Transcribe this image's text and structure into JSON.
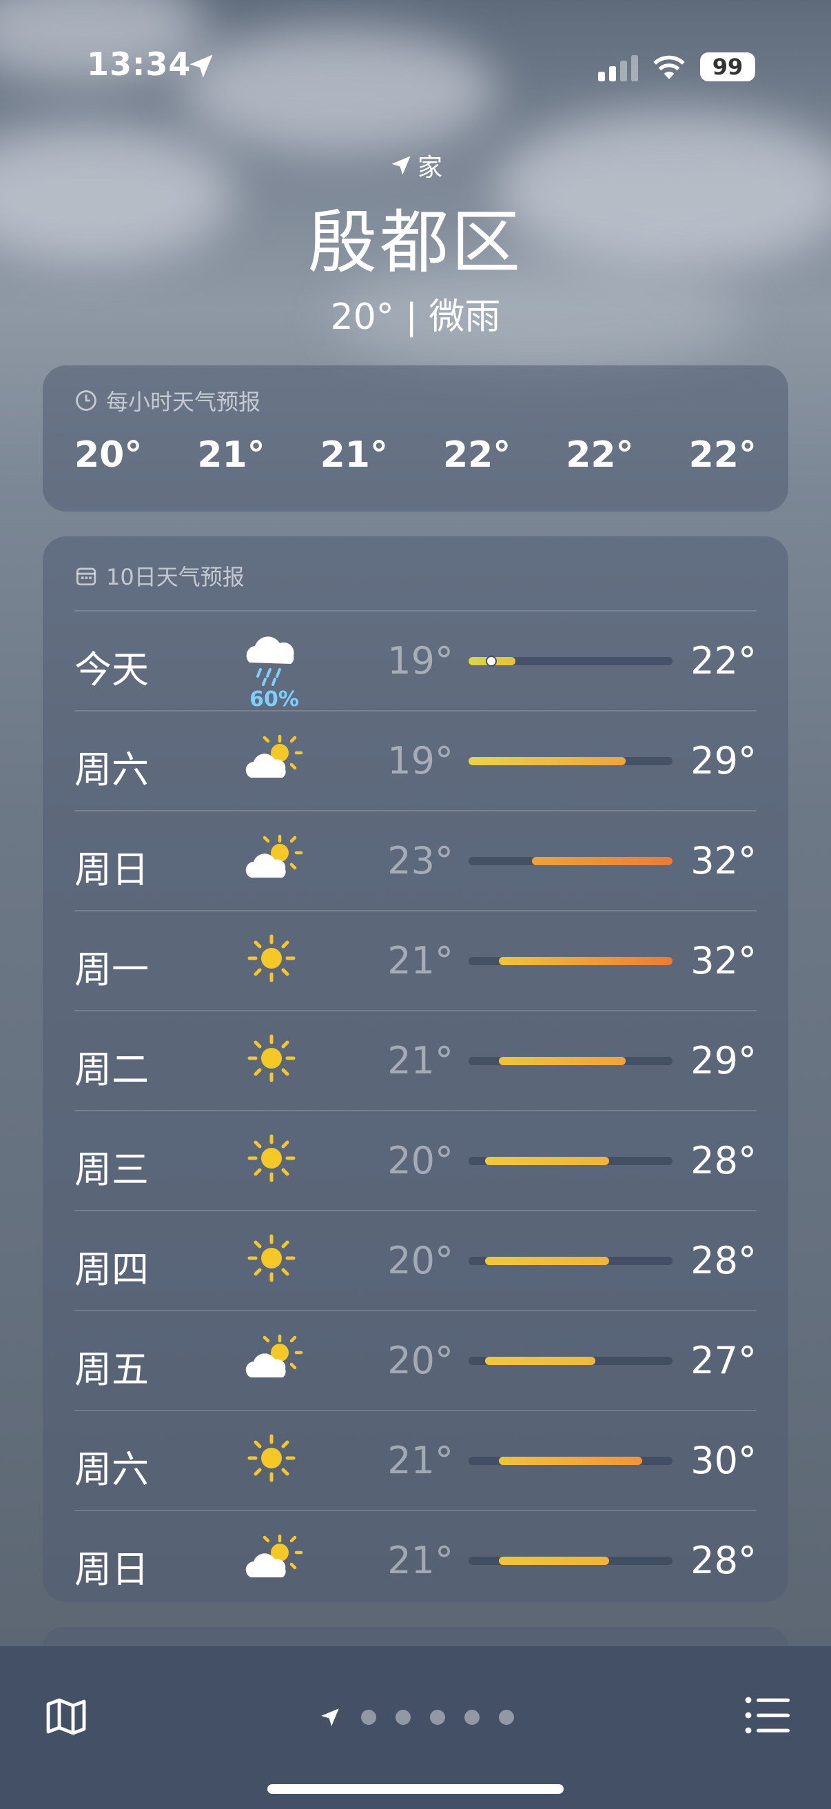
{
  "status": {
    "time": "13:34",
    "battery": "99"
  },
  "location": {
    "home_label": "家",
    "city": "殷都区",
    "current": "20° | 微雨"
  },
  "hourly": {
    "title": "每小时天气预报",
    "temps": [
      "20°",
      "21°",
      "21°",
      "22°",
      "22°",
      "22°"
    ]
  },
  "daily": {
    "title": "10日天气预报",
    "days": [
      {
        "day": "今天",
        "icon": "cloud-rain-icon",
        "precip": "60%",
        "low": "19°",
        "high": "22°",
        "range_start": 0.0,
        "range_end": 0.23,
        "current_marker": 0.11,
        "colors": [
          "#d8d54a",
          "#e8c23a"
        ]
      },
      {
        "day": "周六",
        "icon": "partly-sunny-icon",
        "precip": "",
        "low": "19°",
        "high": "29°",
        "range_start": 0.0,
        "range_end": 0.77,
        "colors": [
          "#ead34a",
          "#efa53c"
        ]
      },
      {
        "day": "周日",
        "icon": "partly-sunny-icon",
        "precip": "",
        "low": "23°",
        "high": "32°",
        "range_start": 0.31,
        "range_end": 1.0,
        "colors": [
          "#f0a23a",
          "#ed7b36"
        ]
      },
      {
        "day": "周一",
        "icon": "sun-icon",
        "precip": "",
        "low": "21°",
        "high": "32°",
        "range_start": 0.15,
        "range_end": 1.0,
        "colors": [
          "#efc43c",
          "#ed7b36"
        ]
      },
      {
        "day": "周二",
        "icon": "sun-icon",
        "precip": "",
        "low": "21°",
        "high": "29°",
        "range_start": 0.15,
        "range_end": 0.77,
        "colors": [
          "#efc43c",
          "#efa33c"
        ]
      },
      {
        "day": "周三",
        "icon": "sun-icon",
        "precip": "",
        "low": "20°",
        "high": "28°",
        "range_start": 0.08,
        "range_end": 0.69,
        "colors": [
          "#efc83e",
          "#efb43c"
        ]
      },
      {
        "day": "周四",
        "icon": "sun-icon",
        "precip": "",
        "low": "20°",
        "high": "28°",
        "range_start": 0.08,
        "range_end": 0.69,
        "colors": [
          "#efc83e",
          "#efb43c"
        ]
      },
      {
        "day": "周五",
        "icon": "partly-sunny-icon",
        "precip": "",
        "low": "20°",
        "high": "27°",
        "range_start": 0.08,
        "range_end": 0.62,
        "colors": [
          "#efc83e",
          "#efba3c"
        ]
      },
      {
        "day": "周六",
        "icon": "sun-icon",
        "precip": "",
        "low": "21°",
        "high": "30°",
        "range_start": 0.15,
        "range_end": 0.85,
        "colors": [
          "#efc43c",
          "#ef963a"
        ]
      },
      {
        "day": "周日",
        "icon": "partly-sunny-icon",
        "precip": "",
        "low": "21°",
        "high": "28°",
        "range_start": 0.15,
        "range_end": 0.69,
        "colors": [
          "#efc43c",
          "#efb43c"
        ]
      }
    ]
  },
  "toolbar": {
    "map": "map-icon",
    "list": "list-icon",
    "page_dots": 5
  },
  "colors": {
    "precip": "#7ccfff",
    "sun": "#f5c727"
  }
}
